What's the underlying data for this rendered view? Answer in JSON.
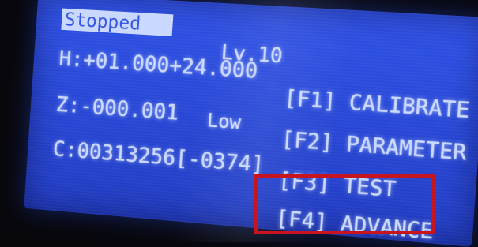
{
  "display": {
    "status": "Stopped",
    "level": "Lv.10",
    "h_reading": "H:+01.000+24.000",
    "z_reading": "Z:-000.001",
    "z_mode": "Low",
    "c_reading": "C:00313256[-0374]"
  },
  "menu": {
    "items": [
      {
        "label": "[F1] CALIBRATE"
      },
      {
        "label": "[F2] PARAMETER"
      },
      {
        "label": "[F3] TEST"
      },
      {
        "label": "[F4] ADVANCE"
      }
    ]
  },
  "colors": {
    "lcd_blue": "#2b4ade",
    "text": "#c9d8ff",
    "highlight": "#c8141e"
  }
}
